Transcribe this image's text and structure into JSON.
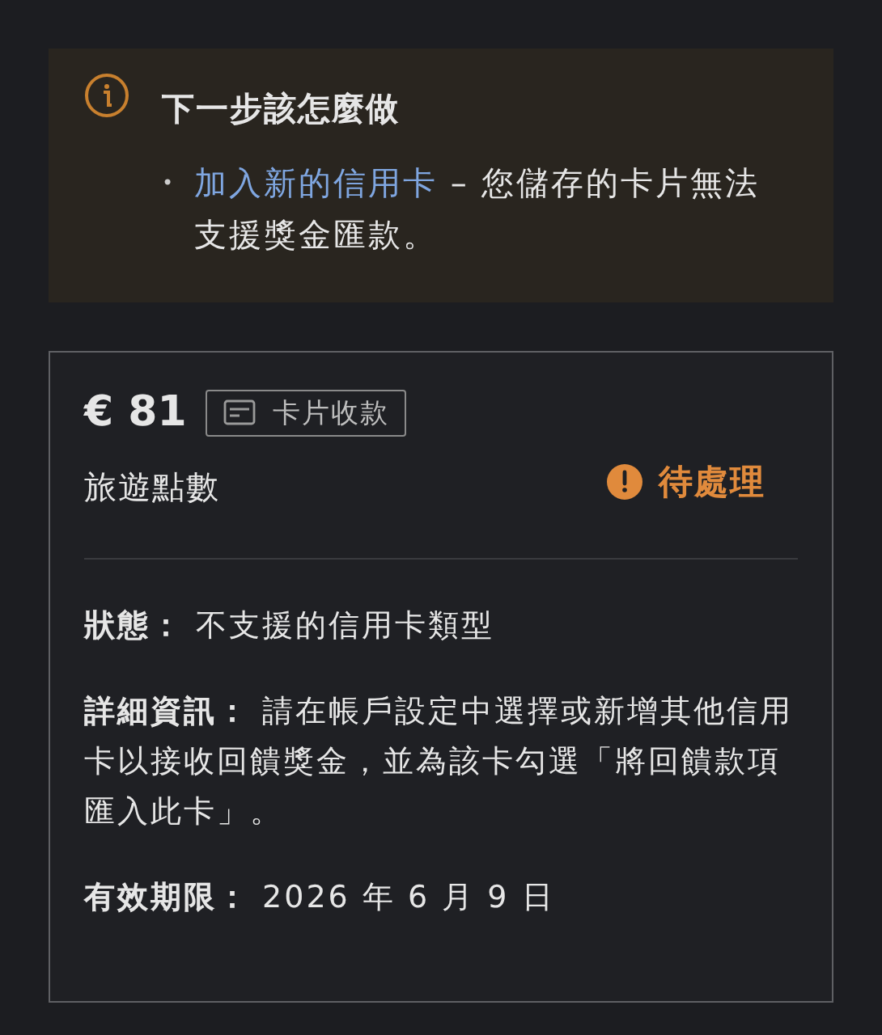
{
  "next_steps": {
    "title": "下一步該怎麼做",
    "items": [
      {
        "marker": "•",
        "link": "加入新的信用卡",
        "text": " – 您儲存的卡片無法支援獎金匯款。"
      }
    ]
  },
  "reward": {
    "amount": "€ 81",
    "tag": "卡片收款",
    "status": {
      "label": "待處理",
      "kind": "pending"
    },
    "name": "旅遊點數",
    "details": [
      "**狀態：** 不支援的信用卡類型",
      "**詳細資訊：** 請在帳戶設定中選擇或新增其他信用卡以接收回饋獎金，並為該卡勾選「將回饋款項匯入此卡」。",
      "**有效期限：** 2026 年 6 月 9 日"
    ]
  }
}
